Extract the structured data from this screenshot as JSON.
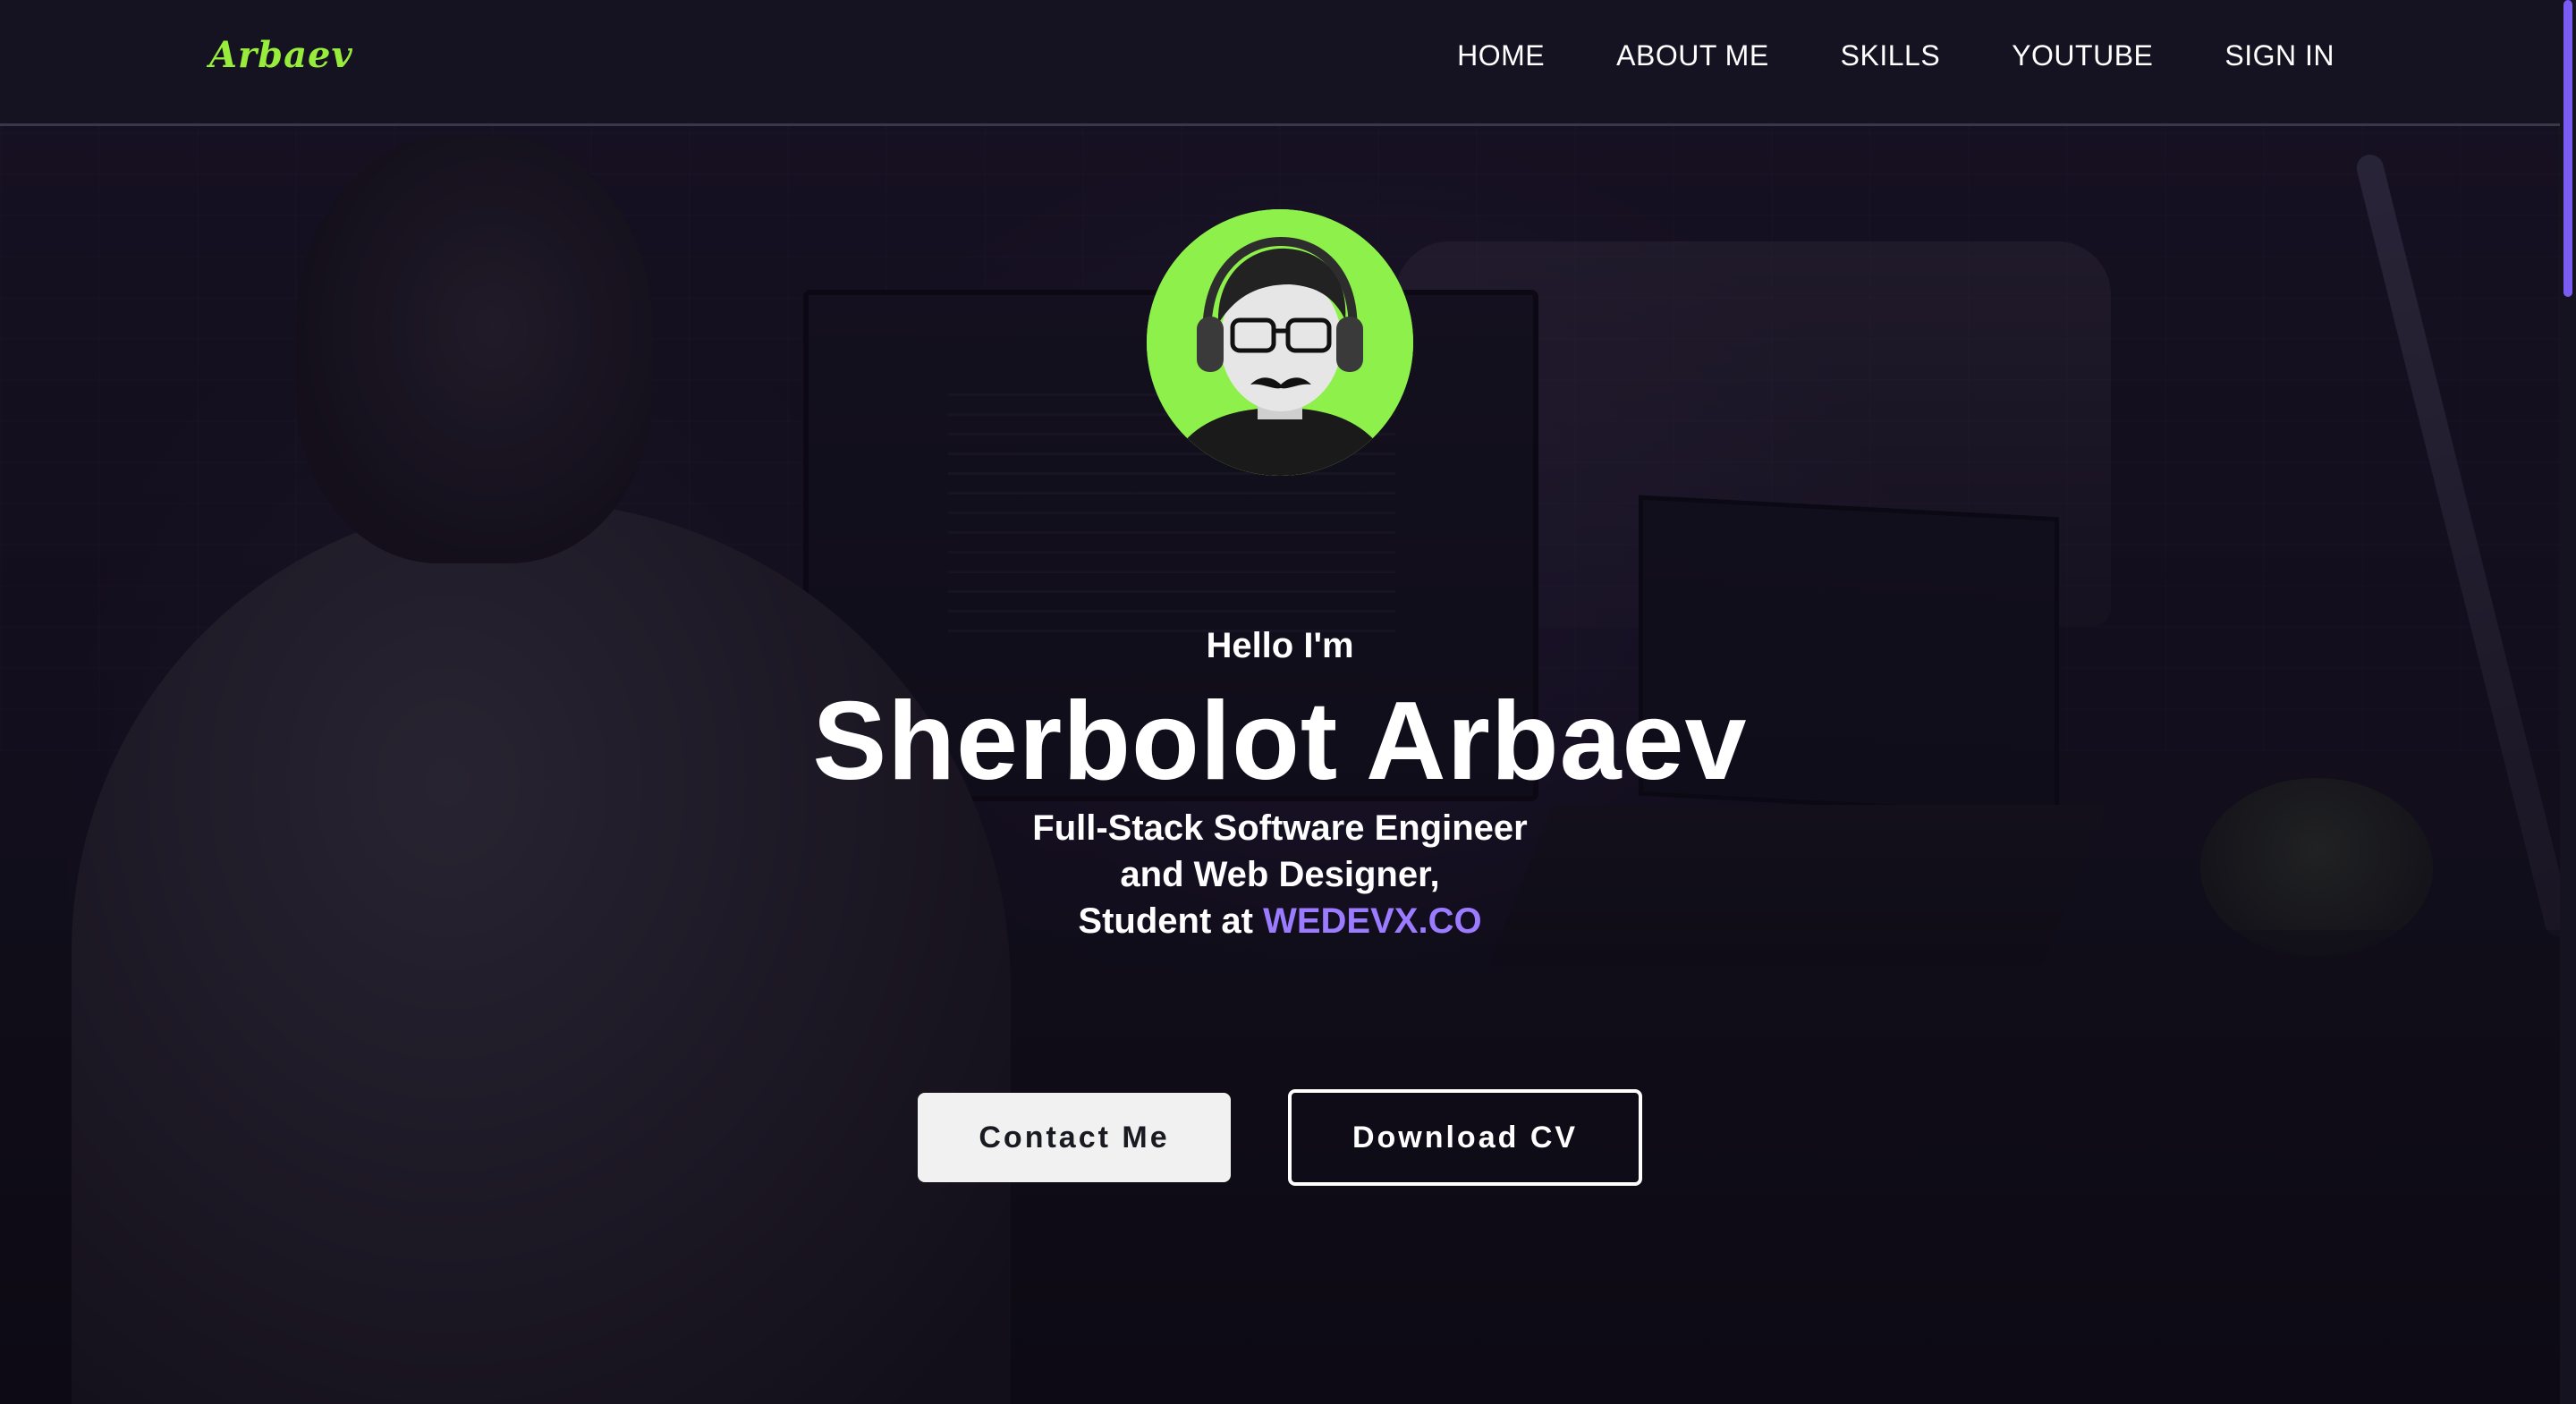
{
  "nav": {
    "logo": "Arbaev",
    "links": [
      "HOME",
      "ABOUT ME",
      "SKILLS",
      "YOUTUBE",
      "SIGN IN"
    ]
  },
  "hero": {
    "greeting": "Hello I'm",
    "name": "Sherbolot Arbaev",
    "tagline_line1": "Full-Stack Software Engineer",
    "tagline_line2": "and Web Designer,",
    "tagline_line3_prefix": "Student at",
    "school": "WEDEVX.CO",
    "contact_button": "Contact Me",
    "cv_button": "Download CV"
  },
  "colors": {
    "accent_green": "#97ec3c",
    "link_purple": "#9b7bff",
    "background": "#13111d"
  },
  "icons": {
    "avatar": "profile-photo"
  }
}
